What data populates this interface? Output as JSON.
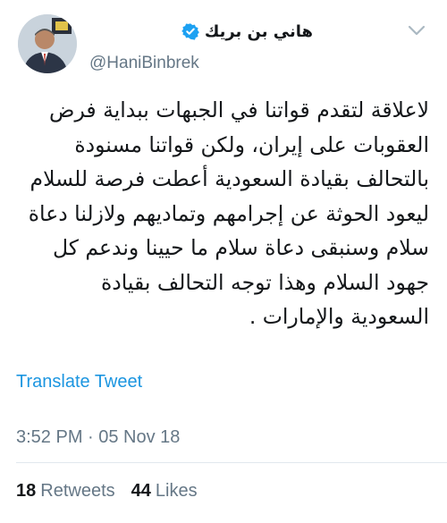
{
  "tweet": {
    "display_name": "هاني بن بريك",
    "handle": "@HaniBinbrek",
    "text": "لاعلاقة لتقدم قواتنا في الجبهات ببداية فرض العقوبات على إيران، ولكن قواتنا مسنودة بالتحالف بقيادة السعودية أعطت فرصة للسلام ليعود الحوثة عن إجرامهم وتماديهم ولازلنا دعاة سلام وسنبقى دعاة سلام ما حيينا وندعم كل جهود السلام وهذا توجه التحالف بقيادة السعودية والإمارات .",
    "translate_label": "Translate Tweet",
    "timestamp": "3:52 PM · 05 Nov 18",
    "retweets_count": "18",
    "retweets_label": "Retweets",
    "likes_count": "44",
    "likes_label": "Likes"
  },
  "colors": {
    "link": "#1b95e0",
    "secondary_text": "#657786",
    "verified": "#1da1f2"
  },
  "icons": {
    "verified": "verified-badge-icon",
    "menu": "chevron-down-icon"
  }
}
